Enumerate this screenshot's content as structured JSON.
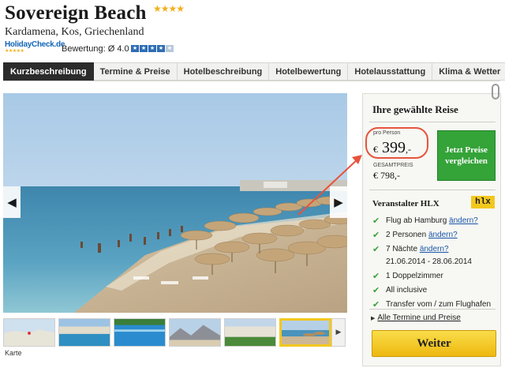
{
  "hotel": {
    "name": "Sovereign Beach",
    "stars": "★★★★",
    "location": "Kardamena, Kos, Griechenland",
    "holidaycheck_logo": "HolidayCheck.de",
    "rating_label": "Bewertung: Ø 4.0",
    "rating_value": 4.0,
    "rating_max": 5
  },
  "tabs": [
    {
      "label": "Kurzbeschreibung",
      "active": true
    },
    {
      "label": "Termine & Preise",
      "active": false
    },
    {
      "label": "Hotelbeschreibung",
      "active": false
    },
    {
      "label": "Hotelbewertung",
      "active": false
    },
    {
      "label": "Hotelausstattung",
      "active": false
    },
    {
      "label": "Klima & Wetter",
      "active": false
    }
  ],
  "gallery": {
    "prev_icon": "chevron-left-icon",
    "next_icon": "chevron-right-icon",
    "thumbnails": [
      {
        "name": "map"
      },
      {
        "name": "hotel-pool"
      },
      {
        "name": "pool"
      },
      {
        "name": "mountains"
      },
      {
        "name": "garden"
      },
      {
        "name": "beach",
        "active": true
      }
    ],
    "map_label": "Karte"
  },
  "trip": {
    "title": "Ihre gewählte Reise",
    "per_person_label": "pro Person",
    "currency": "€",
    "per_person_price": "399",
    "price_suffix": ",-",
    "total_label": "GESAMTPREIS",
    "total_price": "€ 798,-",
    "compare_button": "Jetzt Preise vergleichen",
    "operator_label": "Veranstalter HLX",
    "operator_logo": "hlx",
    "change_label": "ändern?",
    "features": [
      {
        "text": "Flug ab Hamburg",
        "change": true
      },
      {
        "text": "2 Personen",
        "change": true
      },
      {
        "text": "7 Nächte",
        "change": true
      }
    ],
    "date_range": "21.06.2014 - 28.06.2014",
    "features2": [
      {
        "text": "1 Doppelzimmer"
      },
      {
        "text": "All inclusive"
      },
      {
        "text": "Transfer vom / zum Flughafen"
      }
    ],
    "all_dates_link": "Alle Termine und Preise",
    "continue_button": "Weiter"
  },
  "colors": {
    "accent_green": "#34a338",
    "button_yellow": "#f5c91c",
    "annotation_red": "#e6543c",
    "tab_active": "#2b2b2b"
  }
}
